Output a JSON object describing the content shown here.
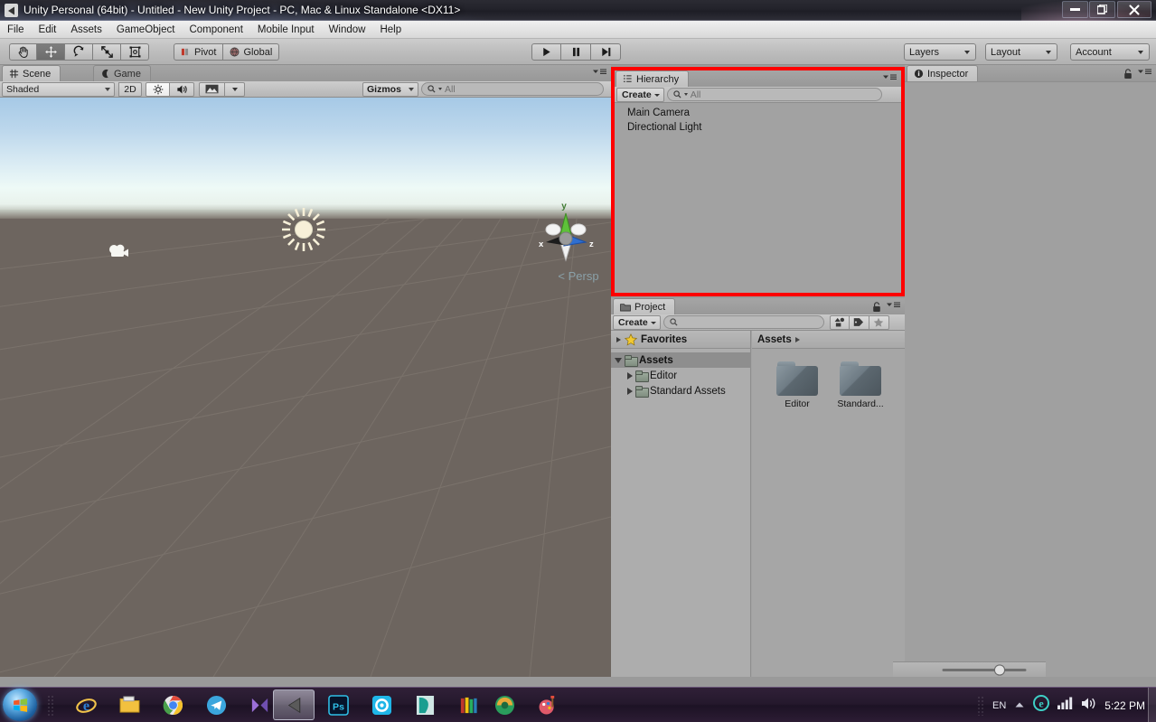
{
  "titlebar": {
    "title": "Unity Personal (64bit) - Untitled - New Unity Project - PC, Mac & Linux Standalone <DX11>",
    "app_icon": "unity-icon",
    "minimize": "—",
    "maximize": "❐",
    "close": "✕"
  },
  "menubar": {
    "items": [
      {
        "label": "File"
      },
      {
        "label": "Edit"
      },
      {
        "label": "Assets"
      },
      {
        "label": "GameObject"
      },
      {
        "label": "Component"
      },
      {
        "label": "Mobile Input"
      },
      {
        "label": "Window"
      },
      {
        "label": "Help"
      }
    ]
  },
  "toolbar": {
    "transform_tools": [
      {
        "name": "hand-tool",
        "icon": "hand-icon",
        "active": false
      },
      {
        "name": "move-tool",
        "icon": "move-icon",
        "active": true
      },
      {
        "name": "rotate-tool",
        "icon": "rotate-icon",
        "active": false
      },
      {
        "name": "scale-tool",
        "icon": "scale-icon",
        "active": false
      },
      {
        "name": "rect-tool",
        "icon": "rect-transform-icon",
        "active": false
      }
    ],
    "pivot_label": "Pivot",
    "space_label": "Global",
    "play_label": "play-icon",
    "pause_label": "pause-icon",
    "step_label": "step-icon",
    "layers_label": "Layers",
    "layout_label": "Layout",
    "account_label": "Account"
  },
  "scene": {
    "tab_label": "Scene",
    "tab_icon": "grid-icon",
    "game_tab_label": "Game",
    "game_tab_icon": "gamepad-icon",
    "draw_mode": "Shaded",
    "two_d_label": "2D",
    "lighting_icon": "sun-icon",
    "audio_icon": "speaker-icon",
    "effects_icon": "image-icon",
    "gizmos_label": "Gizmos",
    "search_placeholder": "All",
    "gizmo_axes": {
      "x": "x",
      "y": "y",
      "z": "z"
    },
    "projection_label": "Persp",
    "objects": [
      {
        "name": "camera-gizmo",
        "label": "Main Camera"
      },
      {
        "name": "light-gizmo",
        "label": "Directional Light"
      }
    ]
  },
  "hierarchy": {
    "tab_label": "Hierarchy",
    "tab_icon": "hierarchy-icon",
    "create_label": "Create",
    "search_placeholder": "All",
    "highlight_color": "#ff0000",
    "items": [
      {
        "label": "Main Camera"
      },
      {
        "label": "Directional Light"
      }
    ]
  },
  "inspector": {
    "tab_label": "Inspector",
    "tab_icon": "info-icon",
    "lock_icon": "lock-icon"
  },
  "project": {
    "tab_label": "Project",
    "tab_icon": "folder-icon",
    "create_label": "Create",
    "search_placeholder": "",
    "toolbar_icons": [
      {
        "name": "filter-by-type-icon"
      },
      {
        "name": "filter-by-label-icon"
      },
      {
        "name": "favorites-star-icon"
      }
    ],
    "favorites_label": "Favorites",
    "tree": [
      {
        "label": "Assets",
        "depth": 0,
        "selected": true,
        "expanded": true
      },
      {
        "label": "Editor",
        "depth": 1,
        "selected": false,
        "expanded": false
      },
      {
        "label": "Standard Assets",
        "depth": 1,
        "selected": false,
        "expanded": false
      }
    ],
    "breadcrumb": "Assets",
    "assets": [
      {
        "label": "Editor"
      },
      {
        "label": "Standard..."
      }
    ],
    "zoom_slider_value": 72
  },
  "taskbar": {
    "start_label": "start-orb",
    "items": [
      {
        "name": "internet-explorer-icon",
        "glyph": "e"
      },
      {
        "name": "file-explorer-icon",
        "glyph": "🗀"
      },
      {
        "name": "google-chrome-icon",
        "glyph": "◉"
      },
      {
        "name": "telegram-icon",
        "glyph": "➤"
      },
      {
        "name": "media-player-icon",
        "glyph": "▶"
      },
      {
        "name": "unity-icon",
        "glyph": "◀",
        "active": true
      },
      {
        "name": "photoshop-icon",
        "glyph": "Ps"
      },
      {
        "name": "app-blue-icon",
        "glyph": "⚙"
      },
      {
        "name": "app-teal-icon",
        "glyph": "✒"
      },
      {
        "name": "app-books-icon",
        "glyph": "☰"
      },
      {
        "name": "app-green-icon",
        "glyph": "◕"
      },
      {
        "name": "paint-icon",
        "glyph": "🎨"
      }
    ],
    "tray": {
      "language": "EN",
      "show_hidden_icon": "chevron-up-icon",
      "network_app_icon": "browser-icon",
      "signal_icon": "signal-bars-icon",
      "volume_icon": "volume-icon",
      "clock": "5:22 PM"
    }
  }
}
